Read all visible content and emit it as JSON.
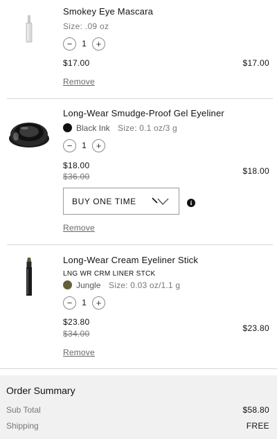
{
  "items": [
    {
      "name": "Smokey Eye Mascara",
      "size": "Size: .09 oz",
      "quantity": "1",
      "price": "$17.00",
      "line_total": "$17.00",
      "remove_label": "Remove",
      "image": "mascara-tube"
    },
    {
      "name": "Long-Wear Smudge-Proof Gel Eyeliner",
      "shade": "Black Ink",
      "shade_color": "#111111",
      "size": "Size: 0.1 oz/3 g",
      "quantity": "1",
      "price": "$18.00",
      "original_price": "$36.00",
      "line_total": "$18.00",
      "purchase_option": "BUY ONE TIME",
      "remove_label": "Remove",
      "image": "gel-eyeliner-pot"
    },
    {
      "name": "Long-Wear Cream Eyeliner Stick",
      "sku": "LNG WR CRM LINER STCK",
      "shade": "Jungle",
      "shade_color": "#66603a",
      "size": "Size: 0.03 oz/1.1 g",
      "quantity": "1",
      "price": "$23.80",
      "original_price": "$34.00",
      "line_total": "$23.80",
      "remove_label": "Remove",
      "image": "eyeliner-stick"
    }
  ],
  "stepper": {
    "minus": "−",
    "plus": "+"
  },
  "summary": {
    "title": "Order Summary",
    "subtotal_label": "Sub Total",
    "subtotal_value": "$58.80",
    "shipping_label": "Shipping",
    "shipping_value": "FREE"
  }
}
